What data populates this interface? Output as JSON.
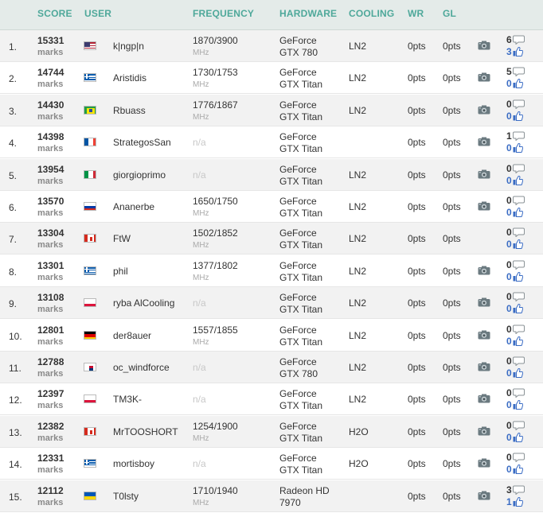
{
  "headers": {
    "score": "SCORE",
    "user": "USER",
    "frequency": "FREQUENCY",
    "hardware": "HARDWARE",
    "cooling": "COOLING",
    "wr": "WR",
    "gl": "GL"
  },
  "unit_label": "marks",
  "mhz_label": "MHz",
  "rows": [
    {
      "rank": "1.",
      "score": "15331",
      "country": "us",
      "user": "k|ngp|n",
      "freq": "1870/3900",
      "hw1": "GeForce",
      "hw2": "GTX 780",
      "cooling": "LN2",
      "wr": "0pts",
      "gl": "0pts",
      "photo": true,
      "comments": "6",
      "likes": "3"
    },
    {
      "rank": "2.",
      "score": "14744",
      "country": "gr",
      "user": "Aristidis",
      "freq": "1730/1753",
      "hw1": "GeForce",
      "hw2": "GTX Titan",
      "cooling": "LN2",
      "wr": "0pts",
      "gl": "0pts",
      "photo": true,
      "comments": "5",
      "likes": "0"
    },
    {
      "rank": "3.",
      "score": "14430",
      "country": "br",
      "user": "Rbuass",
      "freq": "1776/1867",
      "hw1": "GeForce",
      "hw2": "GTX Titan",
      "cooling": "LN2",
      "wr": "0pts",
      "gl": "0pts",
      "photo": true,
      "comments": "0",
      "likes": "0"
    },
    {
      "rank": "4.",
      "score": "14398",
      "country": "fr",
      "user": "StrategosSan",
      "freq": "n/a",
      "hw1": "GeForce",
      "hw2": "GTX Titan",
      "cooling": "",
      "wr": "0pts",
      "gl": "0pts",
      "photo": true,
      "comments": "1",
      "likes": "0"
    },
    {
      "rank": "5.",
      "score": "13954",
      "country": "it",
      "user": "giorgioprimo",
      "freq": "n/a",
      "hw1": "GeForce",
      "hw2": "GTX Titan",
      "cooling": "LN2",
      "wr": "0pts",
      "gl": "0pts",
      "photo": true,
      "comments": "0",
      "likes": "0"
    },
    {
      "rank": "6.",
      "score": "13570",
      "country": "ru",
      "user": "Ananerbe",
      "freq": "1650/1750",
      "hw1": "GeForce",
      "hw2": "GTX Titan",
      "cooling": "LN2",
      "wr": "0pts",
      "gl": "0pts",
      "photo": true,
      "comments": "0",
      "likes": "0"
    },
    {
      "rank": "7.",
      "score": "13304",
      "country": "ca",
      "user": "FtW",
      "freq": "1502/1852",
      "hw1": "GeForce",
      "hw2": "GTX Titan",
      "cooling": "LN2",
      "wr": "0pts",
      "gl": "0pts",
      "photo": false,
      "comments": "0",
      "likes": "0"
    },
    {
      "rank": "8.",
      "score": "13301",
      "country": "gr",
      "user": "phil",
      "freq": "1377/1802",
      "hw1": "GeForce",
      "hw2": "GTX Titan",
      "cooling": "LN2",
      "wr": "0pts",
      "gl": "0pts",
      "photo": true,
      "comments": "0",
      "likes": "0"
    },
    {
      "rank": "9.",
      "score": "13108",
      "country": "pl",
      "user": "ryba AlCooling",
      "freq": "n/a",
      "hw1": "GeForce",
      "hw2": "GTX Titan",
      "cooling": "LN2",
      "wr": "0pts",
      "gl": "0pts",
      "photo": true,
      "comments": "0",
      "likes": "0"
    },
    {
      "rank": "10.",
      "score": "12801",
      "country": "de",
      "user": "der8auer",
      "freq": "1557/1855",
      "hw1": "GeForce",
      "hw2": "GTX Titan",
      "cooling": "LN2",
      "wr": "0pts",
      "gl": "0pts",
      "photo": true,
      "comments": "0",
      "likes": "0"
    },
    {
      "rank": "11.",
      "score": "12788",
      "country": "kr",
      "user": "oc_windforce",
      "freq": "n/a",
      "hw1": "GeForce",
      "hw2": "GTX 780",
      "cooling": "LN2",
      "wr": "0pts",
      "gl": "0pts",
      "photo": true,
      "comments": "0",
      "likes": "0"
    },
    {
      "rank": "12.",
      "score": "12397",
      "country": "pl",
      "user": "TM3K-",
      "freq": "n/a",
      "hw1": "GeForce",
      "hw2": "GTX Titan",
      "cooling": "LN2",
      "wr": "0pts",
      "gl": "0pts",
      "photo": true,
      "comments": "0",
      "likes": "0"
    },
    {
      "rank": "13.",
      "score": "12382",
      "country": "ca",
      "user": "MrTOOSHORT",
      "freq": "1254/1900",
      "hw1": "GeForce",
      "hw2": "GTX Titan",
      "cooling": "H2O",
      "wr": "0pts",
      "gl": "0pts",
      "photo": true,
      "comments": "0",
      "likes": "0"
    },
    {
      "rank": "14.",
      "score": "12331",
      "country": "gr",
      "user": "mortisboy",
      "freq": "n/a",
      "hw1": "GeForce",
      "hw2": "GTX Titan",
      "cooling": "H2O",
      "wr": "0pts",
      "gl": "0pts",
      "photo": true,
      "comments": "0",
      "likes": "0"
    },
    {
      "rank": "15.",
      "score": "12112",
      "country": "ua",
      "user": "T0lsty",
      "freq": "1710/1940",
      "hw1": "Radeon HD",
      "hw2": "7970",
      "cooling": "",
      "wr": "0pts",
      "gl": "0pts",
      "photo": true,
      "comments": "3",
      "likes": "1"
    }
  ],
  "colors": {
    "header_text": "#4ea89a",
    "header_bg": "#e4ebe9",
    "like_count": "#3a6cc4",
    "row_alt": "#f2f2f2"
  },
  "icons": {
    "photo": "camera-icon",
    "comments": "comment-bubble-icon",
    "likes": "thumbs-up-icon"
  }
}
